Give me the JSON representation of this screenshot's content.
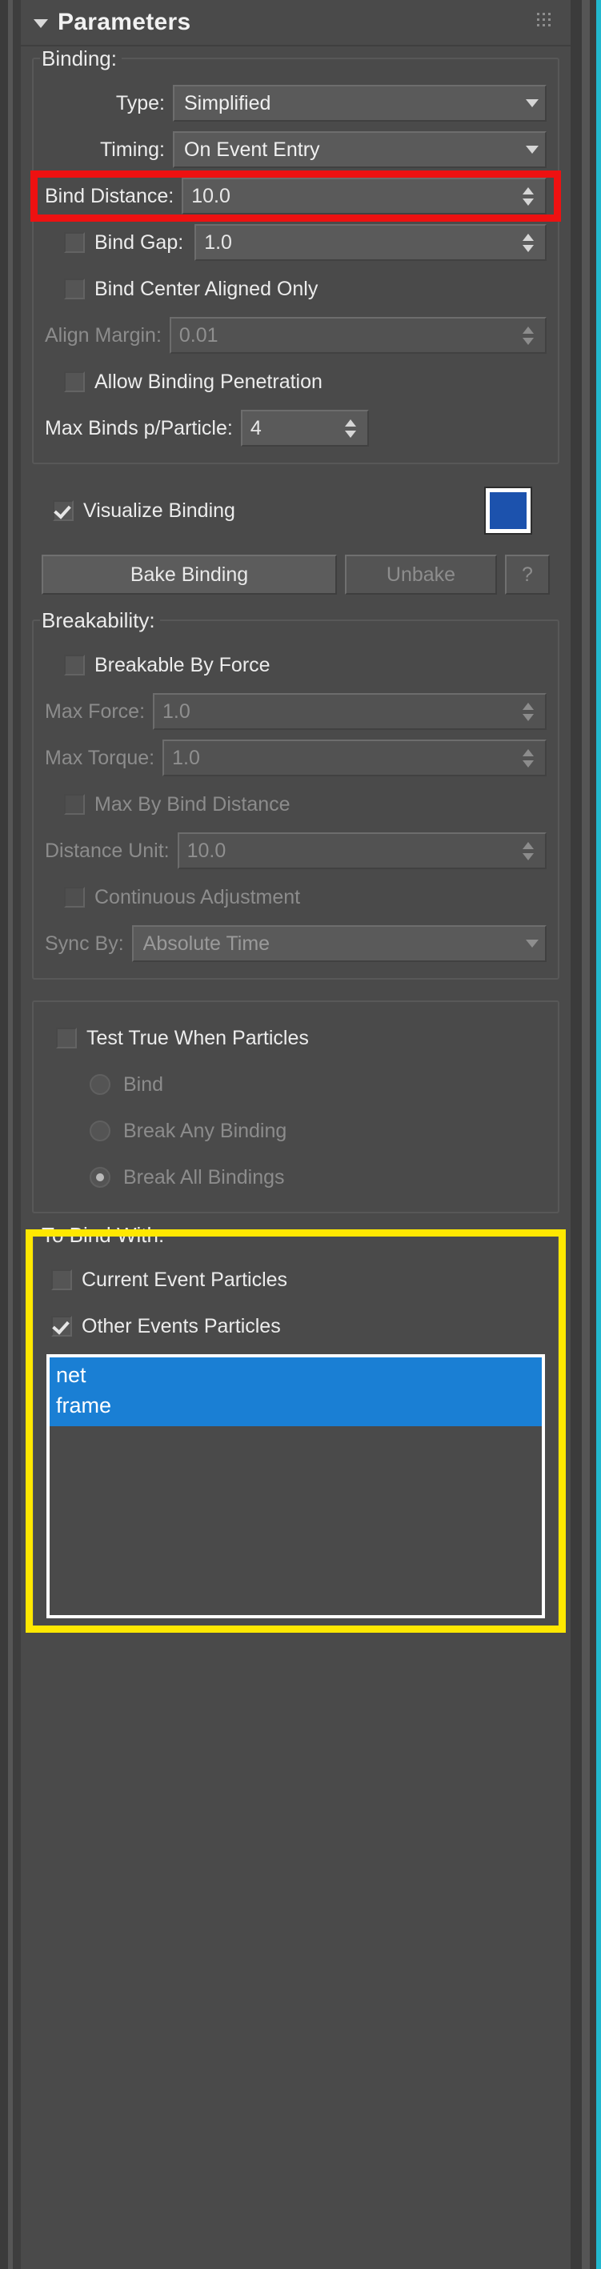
{
  "window": {
    "accent_color": "#22b8cf",
    "panel_bg": "#4a4a4a"
  },
  "rollout": {
    "title": "Parameters",
    "collapse_icon": "triangle-down-icon",
    "grip_icon": "grip-dots-icon"
  },
  "binding_group": {
    "title": "Binding:",
    "type_label": "Type:",
    "type_value": "Simplified",
    "timing_label": "Timing:",
    "timing_value": "On Event Entry",
    "bind_distance_label": "Bind Distance:",
    "bind_distance_value": "10.0",
    "bind_gap_label": "Bind Gap:",
    "bind_gap_value": "1.0",
    "bind_gap_checked": false,
    "bind_center_aligned_label": "Bind Center Aligned Only",
    "bind_center_aligned_checked": false,
    "align_margin_label": "Align Margin:",
    "align_margin_value": "0.01",
    "allow_penetration_label": "Allow Binding Penetration",
    "allow_penetration_checked": false,
    "max_binds_label": "Max Binds p/Particle:",
    "max_binds_value": "4"
  },
  "visualize": {
    "label": "Visualize Binding",
    "checked": true,
    "swatch_color": "#1c52ad"
  },
  "bake_row": {
    "bake_label": "Bake Binding",
    "unbake_label": "Unbake",
    "help_label": "?"
  },
  "breakability_group": {
    "title": "Breakability:",
    "breakable_by_force_label": "Breakable By Force",
    "breakable_by_force_checked": false,
    "max_force_label": "Max Force:",
    "max_force_value": "1.0",
    "max_torque_label": "Max Torque:",
    "max_torque_value": "1.0",
    "max_by_bind_distance_label": "Max By Bind Distance",
    "max_by_bind_distance_checked": false,
    "distance_unit_label": "Distance Unit:",
    "distance_unit_value": "10.0",
    "continuous_adjustment_label": "Continuous Adjustment",
    "continuous_adjustment_checked": false,
    "sync_by_label": "Sync By:",
    "sync_by_value": "Absolute Time"
  },
  "test_group": {
    "title_label": "Test True When Particles",
    "title_checked": false,
    "options": [
      {
        "label": "Bind",
        "selected": false
      },
      {
        "label": "Break Any Binding",
        "selected": false
      },
      {
        "label": "Break All Bindings",
        "selected": true
      }
    ]
  },
  "to_bind_with_group": {
    "title": "To Bind With:",
    "current_event_label": "Current Event Particles",
    "current_event_checked": false,
    "other_events_label": "Other Events Particles",
    "other_events_checked": true,
    "events_list": [
      "net",
      "frame"
    ],
    "events_selected": [
      "net",
      "frame"
    ]
  },
  "annotations": {
    "red_highlight_target": "bind-distance-row",
    "red_highlight_color": "#ee1111",
    "yellow_highlight_target": "to-bind-with-group",
    "yellow_highlight_color": "#ffe800"
  }
}
